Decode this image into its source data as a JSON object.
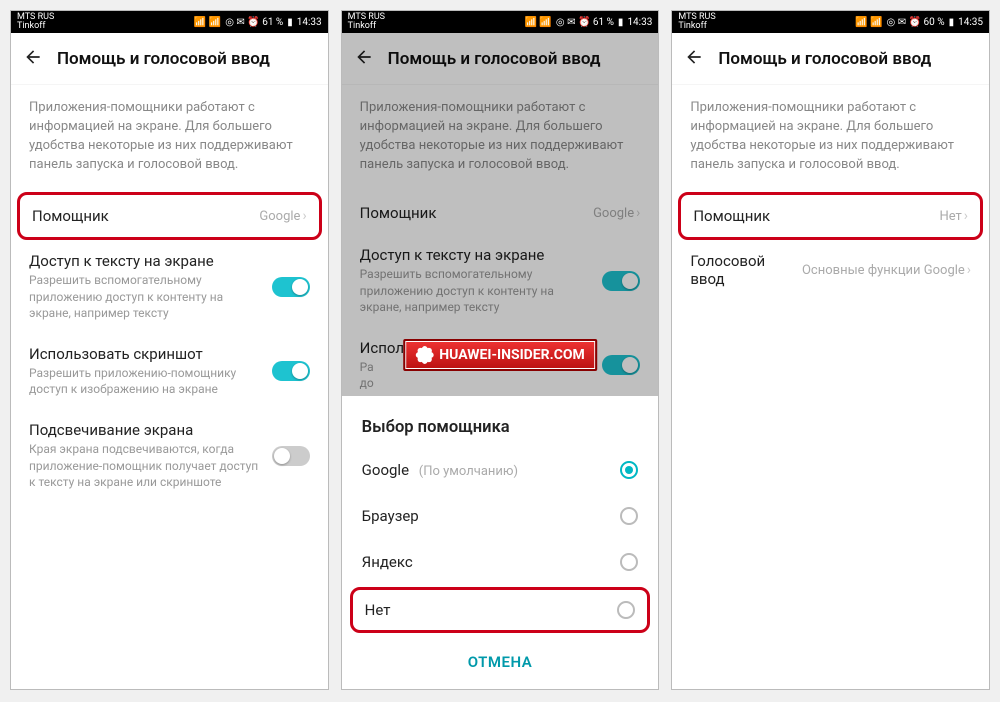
{
  "status": {
    "carrier1": "MTS RUS",
    "carrier2": "Tinkoff",
    "icons": "◎ ✉ ⏰ 61 %",
    "battery_icon": "▮",
    "time1": "14:33",
    "icons3": "◎ ✉ ⏰ 60 %",
    "time3": "14:35"
  },
  "header": {
    "title": "Помощь и голосовой ввод"
  },
  "desc": "Приложения-помощники работают с информацией на экране. Для большего удобства некоторые из них поддерживают панель запуска и голосовой ввод.",
  "rows": {
    "assistant": {
      "label": "Помощник",
      "value_google": "Google",
      "value_none": "Нет"
    },
    "text_access": {
      "label": "Доступ к тексту на экране",
      "sub": "Разрешить вспомогательному приложению доступ к контенту на экране, например тексту"
    },
    "screenshot": {
      "label": "Использовать скриншот",
      "sub": "Разрешить приложению-помощнику доступ к изображению на экране",
      "sub_short": "Ра\nдо"
    },
    "flash": {
      "label": "Подсвечивание экрана",
      "sub": "Края экрана подсвечиваются, когда приложение-помощник получает доступ к тексту на экране или скриншоте"
    },
    "voice": {
      "label": "Голосовой ввод",
      "value": "Основные функции Google"
    }
  },
  "sheet": {
    "title": "Выбор помощника",
    "opts": {
      "google": "Google",
      "google_sub": "(По умолчанию)",
      "browser": "Браузер",
      "yandex": "Яндекс",
      "none": "Нет"
    },
    "cancel": "ОТМЕНА"
  },
  "watermark": "HUAWEI-INSIDER.COM"
}
